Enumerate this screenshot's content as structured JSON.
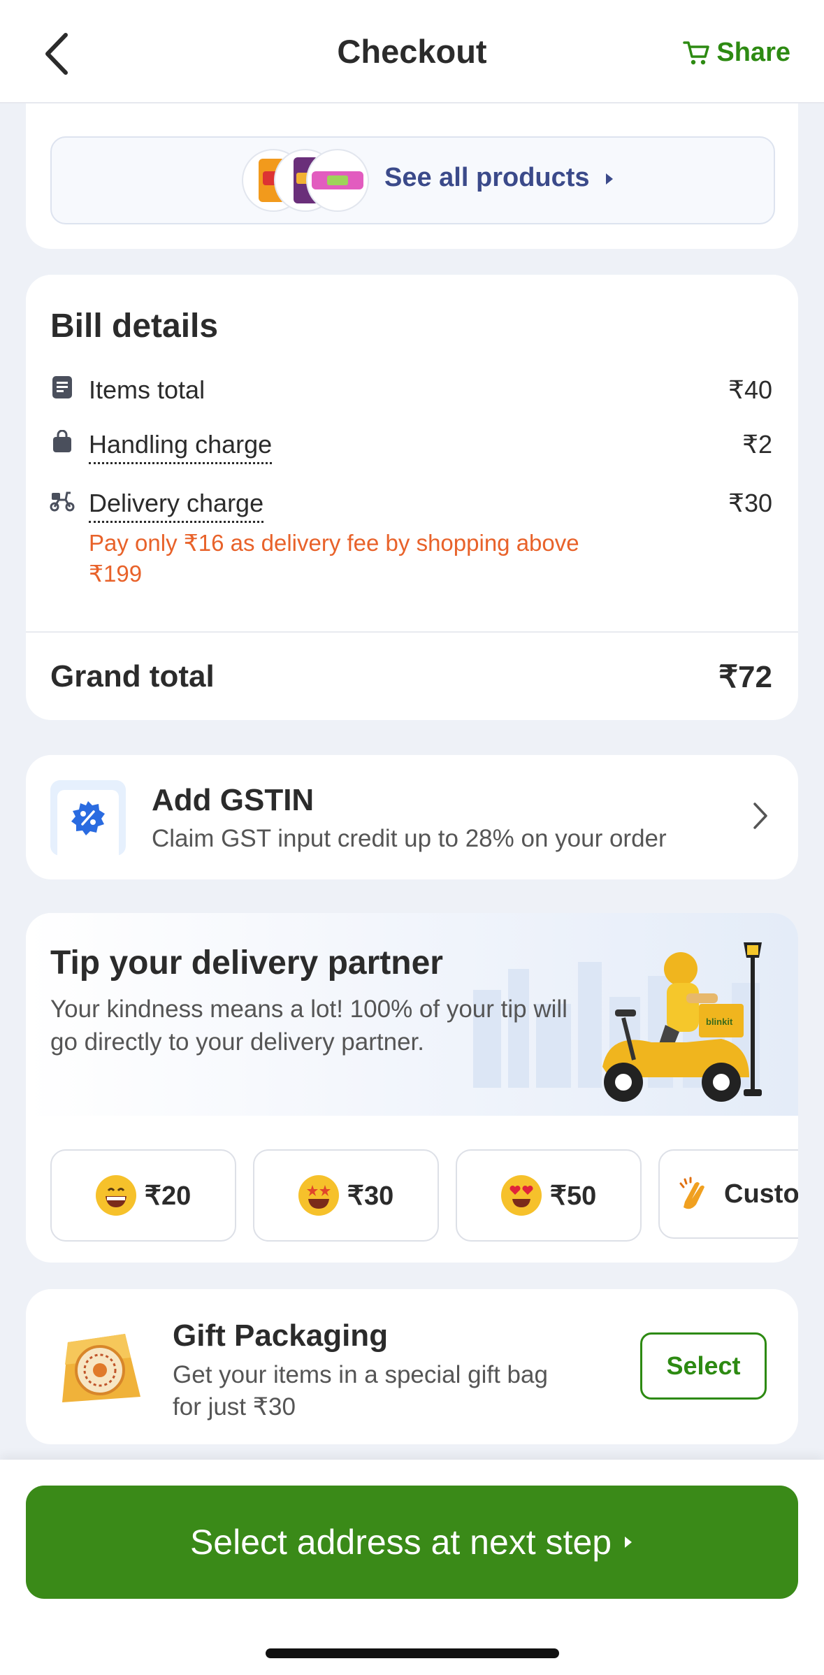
{
  "header": {
    "title": "Checkout",
    "share_label": "Share"
  },
  "products": {
    "see_all_label": "See all products"
  },
  "bill": {
    "title": "Bill details",
    "items_total_label": "Items total",
    "items_total_value": "₹40",
    "handling_label": "Handling charge",
    "handling_value": "₹2",
    "delivery_label": "Delivery charge",
    "delivery_value": "₹30",
    "delivery_note": "Pay only ₹16 as delivery fee by shopping above ₹199",
    "grand_total_label": "Grand total",
    "grand_total_value": "₹72"
  },
  "gstin": {
    "title": "Add GSTIN",
    "subtitle": "Claim GST input credit up to 28% on your order"
  },
  "tip": {
    "title": "Tip your delivery partner",
    "subtitle": "Your kindness means a lot! 100% of your tip will go directly to your delivery partner.",
    "scooter_brand": "blinkit",
    "options": [
      {
        "label": "₹20",
        "icon": "grinning-face-icon"
      },
      {
        "label": "₹30",
        "icon": "star-struck-face-icon"
      },
      {
        "label": "₹50",
        "icon": "heart-eyes-face-icon"
      },
      {
        "label": "Custo",
        "icon": "clapping-hands-icon"
      }
    ]
  },
  "gift": {
    "title": "Gift Packaging",
    "subtitle": "Get your items in a special gift bag for just ₹30",
    "select_label": "Select"
  },
  "cta": {
    "label": "Select address at next step"
  },
  "colors": {
    "brand_green": "#3a8a18",
    "accent_orange": "#e8622a",
    "link_blue": "#3b4a8a"
  }
}
